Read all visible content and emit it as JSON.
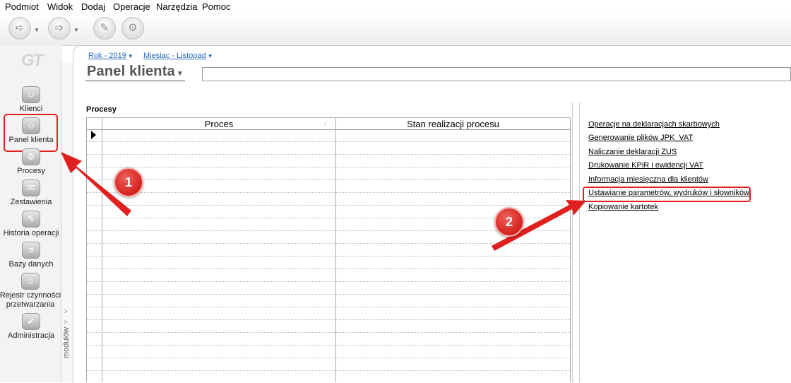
{
  "menu": [
    "Podmiot",
    "Widok",
    "Dodaj",
    "Operacje",
    "Narzędzia",
    "Pomoc"
  ],
  "toolbar": {
    "icons": [
      "back-icon",
      "forward-icon",
      "brush-icon",
      "settings-icon"
    ]
  },
  "logo_text": "GT",
  "sidebar": {
    "items": [
      {
        "label": "Klienci",
        "icon": "client-icon"
      },
      {
        "label": "Panel klienta",
        "icon": "client-panel-icon"
      },
      {
        "label": "Procesy",
        "icon": "gears-icon"
      },
      {
        "label": "Zestawienia",
        "icon": "report-icon"
      },
      {
        "label": "Historia operacji",
        "icon": "history-icon"
      },
      {
        "label": "Bazy danych",
        "icon": "database-icon"
      },
      {
        "label": "Rejestr czynności przetwarzania",
        "icon": "register-icon"
      },
      {
        "label": "Administracja",
        "icon": "admin-icon"
      }
    ],
    "active": "Panel klienta",
    "modules_label": "modułów"
  },
  "breadcrumb": {
    "year": "Rok - 2019",
    "month": "Miesiąc - Listopad"
  },
  "panel": {
    "title": "Panel klienta",
    "search_value": ""
  },
  "processes": {
    "section_label": "Procesy",
    "columns": [
      "Proces",
      "Stan realizacji procesu"
    ],
    "row_count": 21
  },
  "links": [
    "Operacje na deklaracjach skarbowych",
    "Generowanie plików JPK_VAT",
    "Naliczanie deklaracji ZUS",
    "Drukowanie KPiR i ewidencji VAT",
    "Informacja miesięczna dla klientów",
    "Ustawianie parametrów, wydruków i słowników",
    "Kopiowanie kartotek"
  ],
  "callouts": [
    "1",
    "2"
  ],
  "colors": {
    "highlight": "#e0201f",
    "link_blue": "#2466b8"
  }
}
